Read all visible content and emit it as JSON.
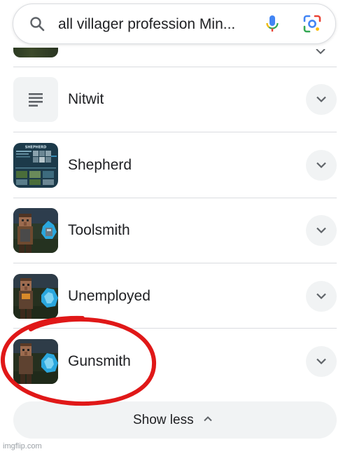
{
  "search": {
    "query": "all villager profession Min...",
    "icon": "search-icon",
    "voice_icon": "mic-icon",
    "lens_icon": "lens-icon"
  },
  "results": {
    "items": [
      {
        "label": "Nitwit",
        "thumb": "text-lines-icon"
      },
      {
        "label": "Shepherd",
        "thumb": "shepherd-image",
        "thumb_title": "SHEPHERD"
      },
      {
        "label": "Toolsmith",
        "thumb": "toolsmith-image"
      },
      {
        "label": "Unemployed",
        "thumb": "unemployed-image"
      },
      {
        "label": "Gunsmith",
        "thumb": "gunsmith-image"
      }
    ]
  },
  "show_less": {
    "label": "Show less"
  },
  "annotation": {
    "color": "#e01818"
  },
  "watermark": {
    "text": "imgflip.com"
  },
  "colors": {
    "divider": "#dadce0",
    "button_bg": "#f1f3f4",
    "text": "#202124"
  }
}
